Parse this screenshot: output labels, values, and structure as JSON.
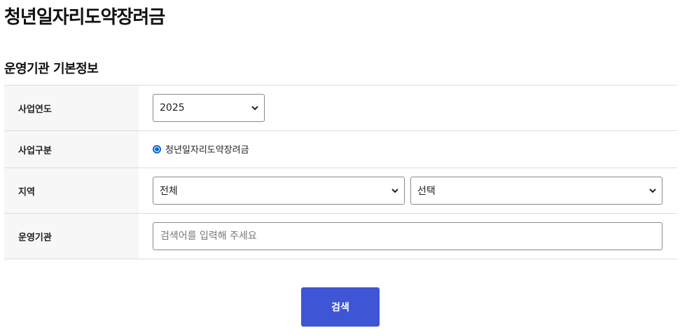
{
  "page": {
    "title": "청년일자리도약장려금"
  },
  "section": {
    "title": "운영기관 기본정보"
  },
  "form": {
    "year": {
      "label": "사업연도",
      "value": "2025"
    },
    "program": {
      "label": "사업구분",
      "option": "청년일자리도약장려금",
      "selected": true
    },
    "region": {
      "label": "지역",
      "primary_value": "전체",
      "secondary_value": "선택"
    },
    "agency": {
      "label": "운영기관",
      "placeholder": "검색어를 입력해 주세요",
      "value": ""
    }
  },
  "actions": {
    "search_label": "검색"
  },
  "colors": {
    "accent": "#3e55d6",
    "radio": "#0a66d8",
    "label_bg": "#f7f7f7",
    "border": "#dcdcdc"
  }
}
